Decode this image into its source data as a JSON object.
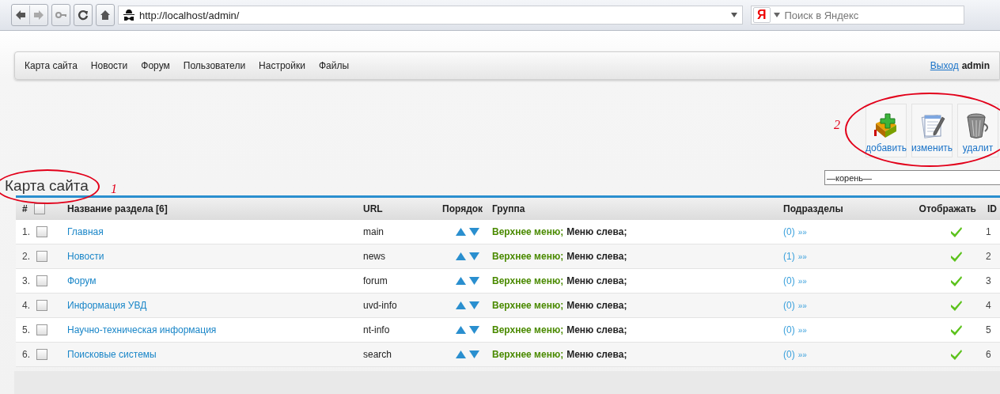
{
  "browser": {
    "address": "http://localhost/admin/",
    "search_engine_letter": "Я",
    "search_placeholder": "Поиск в Яндекс"
  },
  "nav": {
    "items": [
      "Карта сайта",
      "Новости",
      "Форум",
      "Пользователи",
      "Настройки",
      "Файлы"
    ],
    "logout": "Выход",
    "user": "admin"
  },
  "actions": [
    {
      "label": "добавить",
      "kind": "add"
    },
    {
      "label": "изменить",
      "kind": "edit"
    },
    {
      "label": "удалит",
      "kind": "delete"
    }
  ],
  "actions_annotation": "2",
  "title": {
    "text": "Карта сайта",
    "annotation": "1"
  },
  "parent_select": {
    "value": "—корень—"
  },
  "table": {
    "columns": [
      "#",
      "Название раздела [6]",
      "URL",
      "Порядок",
      "Группа",
      "Подразделы",
      "Отображать",
      "ID"
    ],
    "select_all_checked": false,
    "rows": [
      {
        "number": "1.",
        "checked": false,
        "name": "Главная",
        "url": "main",
        "groups": [
          {
            "label": "Верхнее меню;",
            "highlighted": true
          },
          {
            "label": "Меню слева;",
            "highlighted": false
          }
        ],
        "subsections": "(0)",
        "subsections_link": "»»",
        "visible": true,
        "id": "1"
      },
      {
        "number": "2.",
        "checked": false,
        "name": "Новости",
        "url": "news",
        "groups": [
          {
            "label": "Верхнее меню;",
            "highlighted": true
          },
          {
            "label": "Меню слева;",
            "highlighted": false
          }
        ],
        "subsections": "(1)",
        "subsections_link": "»»",
        "visible": true,
        "id": "2"
      },
      {
        "number": "3.",
        "checked": false,
        "name": "Форум",
        "url": "forum",
        "groups": [
          {
            "label": "Верхнее меню;",
            "highlighted": true
          },
          {
            "label": "Меню слева;",
            "highlighted": false
          }
        ],
        "subsections": "(0)",
        "subsections_link": "»»",
        "visible": true,
        "id": "3"
      },
      {
        "number": "4.",
        "checked": false,
        "name": "Информация УВД",
        "url": "uvd-info",
        "groups": [
          {
            "label": "Верхнее меню;",
            "highlighted": true
          },
          {
            "label": "Меню слева;",
            "highlighted": false
          }
        ],
        "subsections": "(0)",
        "subsections_link": "»»",
        "visible": true,
        "id": "4"
      },
      {
        "number": "5.",
        "checked": false,
        "name": "Научно-техническая информация",
        "url": "nt-info",
        "groups": [
          {
            "label": "Верхнее меню;",
            "highlighted": true
          },
          {
            "label": "Меню слева;",
            "highlighted": false
          }
        ],
        "subsections": "(0)",
        "subsections_link": "»»",
        "visible": true,
        "id": "5"
      },
      {
        "number": "6.",
        "checked": false,
        "name": "Поисковые системы",
        "url": "search",
        "groups": [
          {
            "label": "Верхнее меню;",
            "highlighted": true
          },
          {
            "label": "Меню слева;",
            "highlighted": false
          }
        ],
        "subsections": "(0)",
        "subsections_link": "»»",
        "visible": true,
        "id": "6"
      }
    ]
  }
}
